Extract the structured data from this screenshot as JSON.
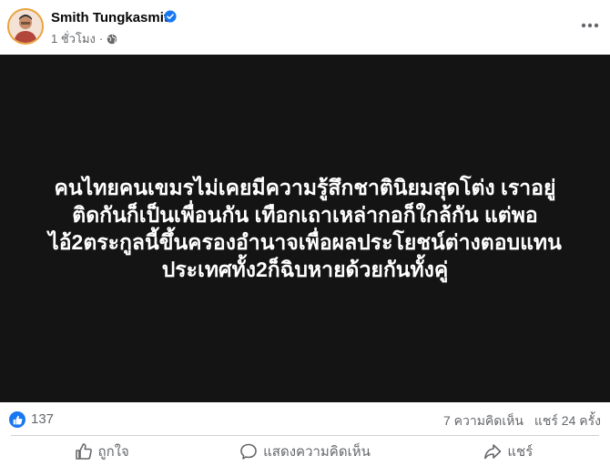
{
  "post": {
    "author": "Smith Tungkasmit",
    "time": "1 ชั่วโมง",
    "text": "คนไทยคนเขมรไม่เคยมีความรู้สึกชาตินิยมสุดโต่ง เราอยู่\nติดกันก็เป็นเพื่อนกัน เทือกเถาเหล่ากอก็ใกล้กัน แต่พอ\nไอ้2ตระกูลนี้ขึ้นครองอำนาจเพื่อผลประโยชน์ต่างตอบแทน\nประเทศทั้ง2ก็ฉิบหายด้วยกันทั้งคู่"
  },
  "stats": {
    "likes": "137",
    "comments": "7 ความคิดเห็น",
    "shares": "แชร์ 24 ครั้ง"
  },
  "actions": {
    "like": "ถูกใจ",
    "comment": "แสดงความคิดเห็น",
    "share": "แชร์"
  },
  "icons": {
    "verified": "verified-badge-icon",
    "globe": "globe-icon",
    "more": "more-options-icon",
    "like": "thumbs-up-icon",
    "comment": "comment-bubble-icon",
    "share": "share-arrow-icon"
  },
  "colors": {
    "brand": "#1877f2",
    "card_background": "#141414",
    "muted_text": "#65676b"
  }
}
